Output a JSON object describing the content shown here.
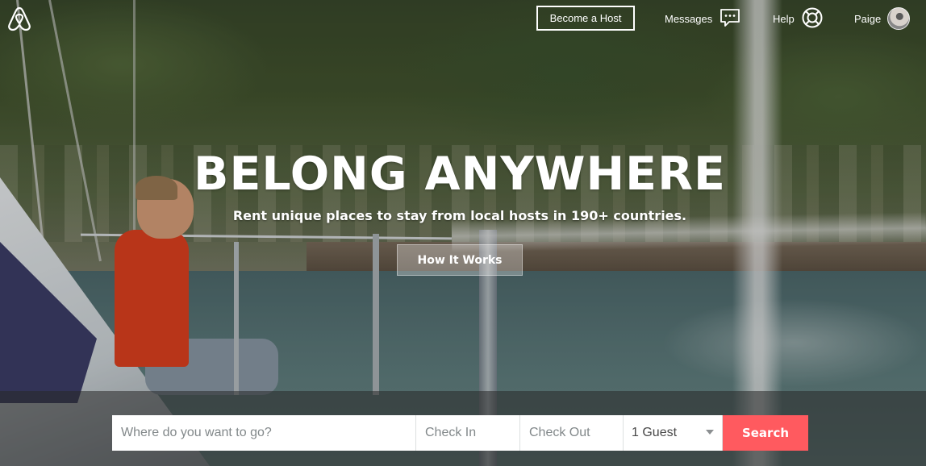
{
  "nav": {
    "logo_icon": "airbnb-logo-icon",
    "become_host": "Become a Host",
    "messages": "Messages",
    "messages_icon": "message-bubble-icon",
    "help": "Help",
    "help_icon": "lifebuoy-icon",
    "user_name": "Paige"
  },
  "hero": {
    "headline": "BELONG ANYWHERE",
    "subline": "Rent unique places to stay from local hosts in 190+ countries.",
    "how_it_works": "How It Works"
  },
  "search": {
    "where_placeholder": "Where do you want to go?",
    "checkin_placeholder": "Check In",
    "checkout_placeholder": "Check Out",
    "guests_value": "1 Guest",
    "submit_label": "Search"
  },
  "colors": {
    "accent": "#ff5a5f",
    "text_on_image": "#ffffff"
  }
}
